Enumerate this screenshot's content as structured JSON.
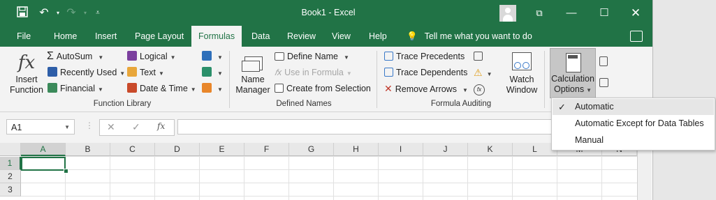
{
  "titlebar": {
    "title": "Book1  -  Excel",
    "qat": [
      "save-icon",
      "undo-icon",
      "redo-icon",
      "customize-icon"
    ]
  },
  "tabs": [
    "File",
    "Home",
    "Insert",
    "Page Layout",
    "Formulas",
    "Data",
    "Review",
    "View",
    "Help"
  ],
  "active_tab": "Formulas",
  "tellme": "Tell me what you want to do",
  "ribbon": {
    "insert_function": [
      "Insert",
      "Function"
    ],
    "autosum": "AutoSum",
    "recently_used": "Recently Used",
    "financial": "Financial",
    "logical": "Logical",
    "text": "Text",
    "date_time": "Date & Time",
    "function_library_label": "Function Library",
    "name_manager": [
      "Name",
      "Manager"
    ],
    "define_name": "Define Name",
    "use_in_formula": "Use in Formula",
    "create_from_selection": "Create from Selection",
    "defined_names_label": "Defined Names",
    "trace_precedents": "Trace Precedents",
    "trace_dependents": "Trace Dependents",
    "remove_arrows": "Remove Arrows",
    "watch_window": [
      "Watch",
      "Window"
    ],
    "formula_auditing_label": "Formula Auditing",
    "calculation_options": [
      "Calculation",
      "Options"
    ]
  },
  "formula_bar": {
    "name_box": "A1",
    "fx": "fx",
    "formula": ""
  },
  "columns": [
    "A",
    "B",
    "C",
    "D",
    "E",
    "F",
    "G",
    "H",
    "I",
    "J",
    "K",
    "L",
    "M",
    "N"
  ],
  "rows": [
    "1",
    "2",
    "3"
  ],
  "selected_cell": "A1",
  "calc_menu": {
    "items": [
      "Automatic",
      "Automatic Except for Data Tables",
      "Manual"
    ],
    "checked": "Automatic"
  },
  "colors": {
    "accent": "#217346"
  }
}
